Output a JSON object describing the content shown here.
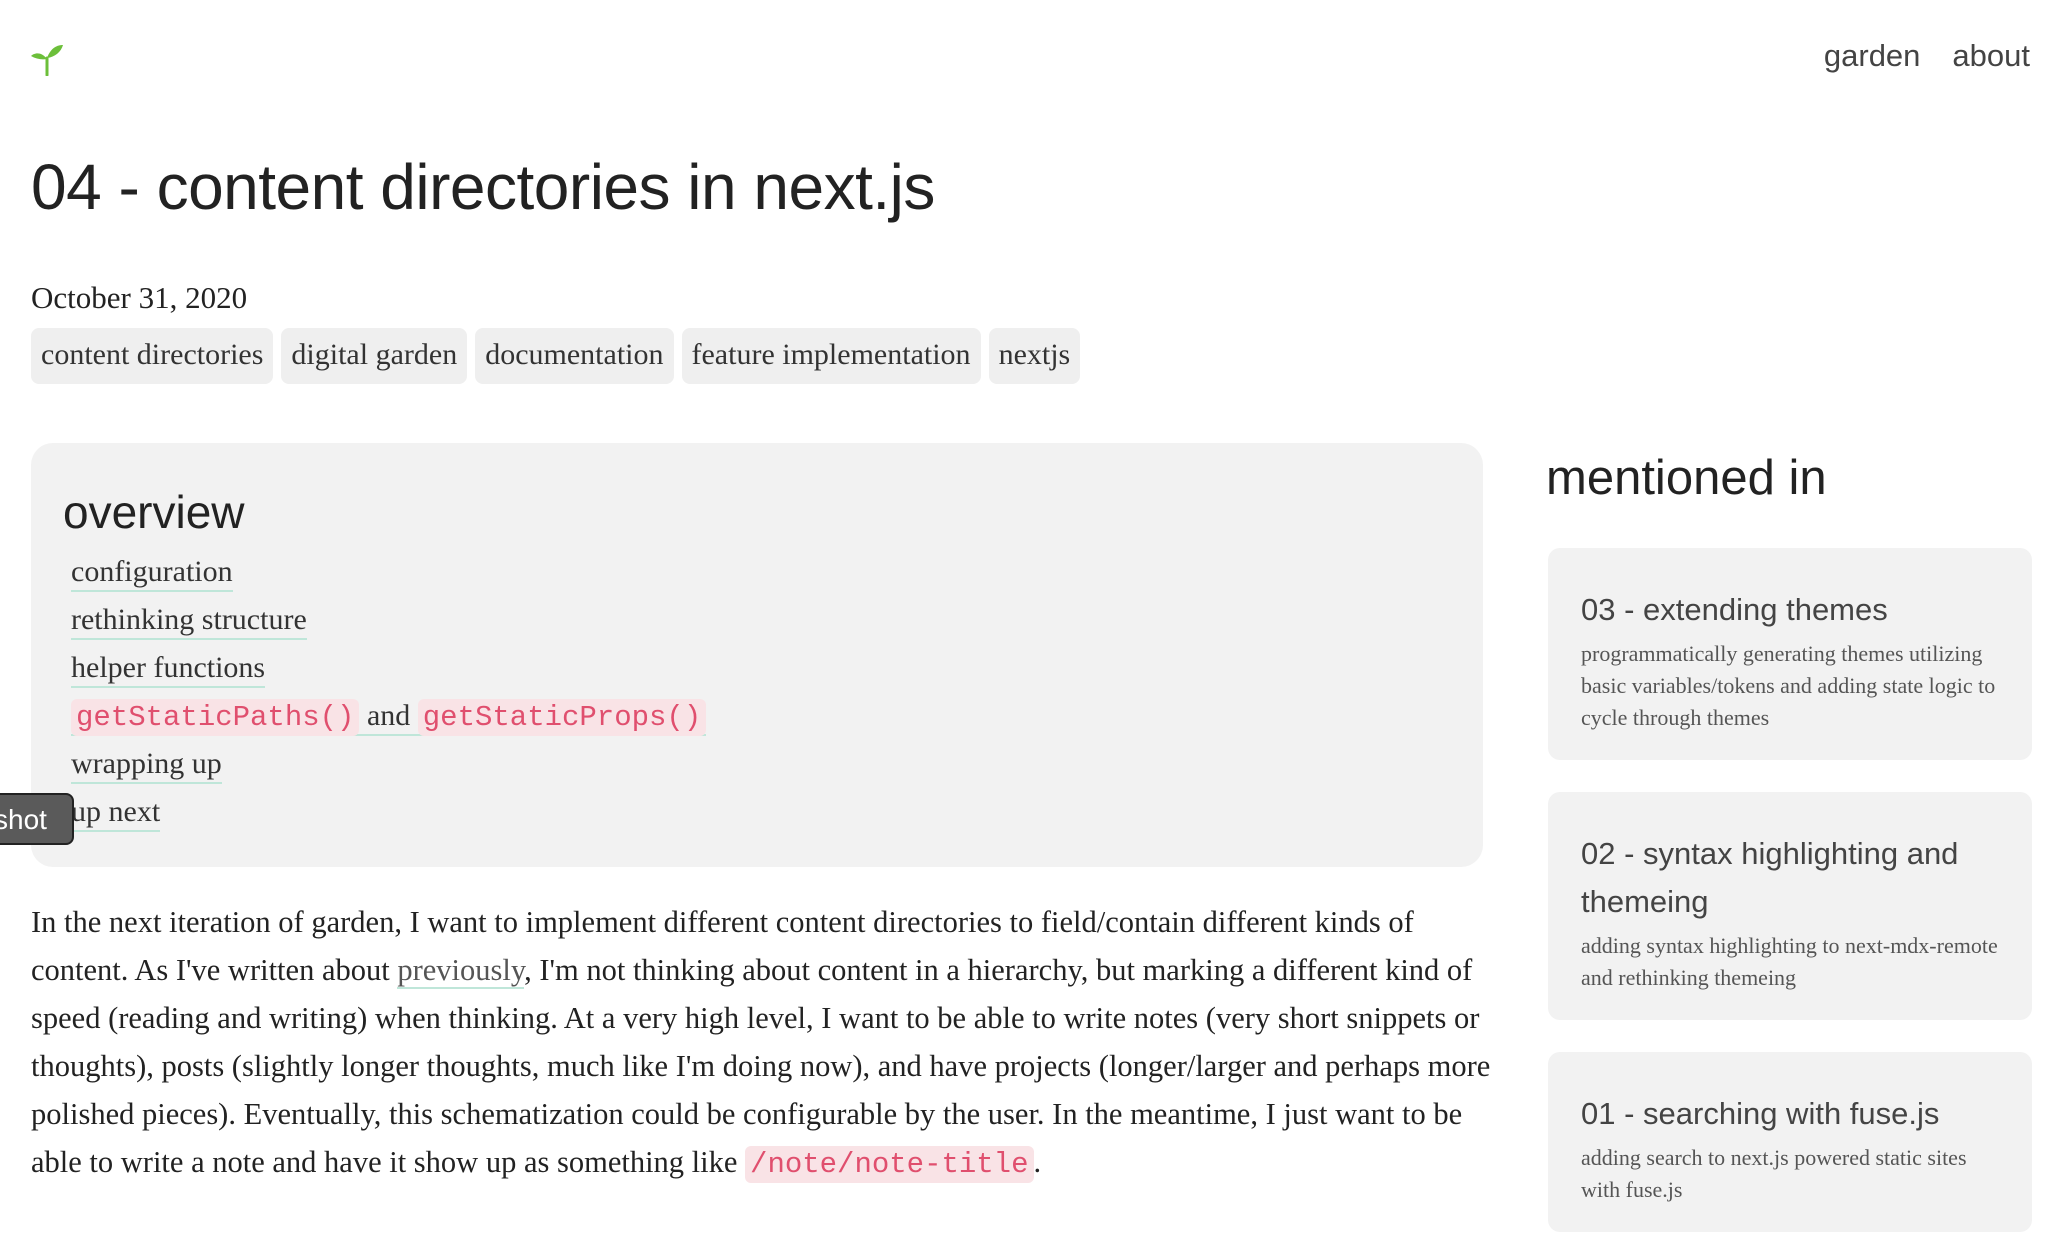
{
  "nav": {
    "garden": "garden",
    "about": "about"
  },
  "logo_icon": "seedling-icon",
  "accent_color": "#6cbf3a",
  "page_title": "04 - content directories in next.js",
  "date": "October 31, 2020",
  "tags": [
    "content directories",
    "digital garden",
    "documentation",
    "feature implementation",
    "nextjs"
  ],
  "overview": {
    "heading": "overview",
    "items": [
      "configuration",
      "rethinking structure",
      "helper functions"
    ],
    "code_item": {
      "first": "getStaticPaths()",
      "joiner": " and ",
      "second": "getStaticProps()"
    },
    "items_after": [
      "wrapping up",
      "up next"
    ]
  },
  "screenshot_button": "shot",
  "body": {
    "p1_a": "In the next iteration of garden, I want to implement different content directories to field/contain different kinds of content. As I've written about ",
    "link": "previously",
    "p1_b": ", I'm not thinking about content in a hierarchy, but marking a different kind of speed (reading and writing) when thinking. At a very high level, I want to be able to write notes (very short snippets or thoughts), posts (slightly longer thoughts, much like I'm doing now), and have projects (longer/larger and perhaps more polished pieces). Eventually, this schematization could be configurable by the user. In the meantime, I just want to be able to write a note and have it show up as something like ",
    "code": "/note/note-title",
    "end": "."
  },
  "mentioned": {
    "heading": "mentioned in",
    "cards": [
      {
        "title": "03 - extending themes",
        "desc": "programmatically generating themes utilizing basic variables/tokens and adding state logic to cycle through themes"
      },
      {
        "title": "02 - syntax highlighting and themeing",
        "desc": "adding syntax highlighting to next-mdx-remote and rethinking themeing"
      },
      {
        "title": "01 - searching with fuse.js",
        "desc": "adding search to next.js powered static sites with fuse.js"
      }
    ]
  }
}
